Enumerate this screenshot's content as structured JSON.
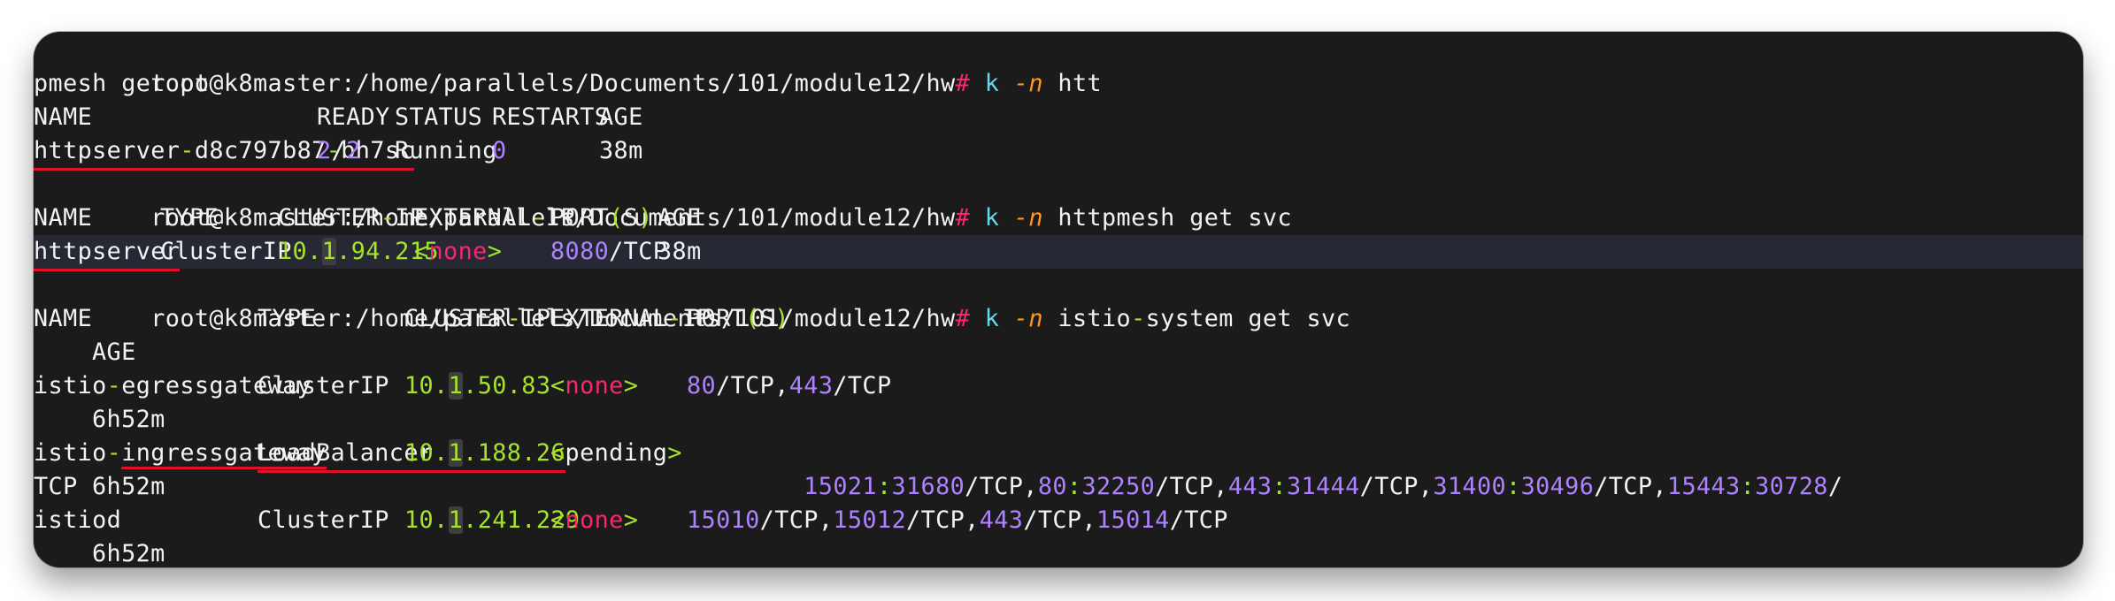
{
  "terminal": {
    "line1": {
      "prompt_user": "root@k8master:/home/parallels/Documents/101/module12/hw",
      "prompt_hash": "#",
      "k": "k",
      "flag": "-n",
      "arg": "htt"
    },
    "line2": {
      "text": "pmesh get po"
    },
    "pods_header": {
      "name": "NAME",
      "ready": "READY",
      "status": "STATUS",
      "restarts": "RESTARTS",
      "age": "AGE"
    },
    "pod_row": {
      "name_a": "httpserver",
      "dash": "-",
      "name_b": "d8c797b87",
      "name_c": "bh7sc",
      "ready_num": "2",
      "ready_sep": "/",
      "ready_den": "2",
      "status": "Running",
      "restarts": "0",
      "age": "38m"
    },
    "cmd2": {
      "prompt_user": "root@k8master:/home/parallels/Documents/101/module12/hw",
      "prompt_hash": "#",
      "k": "k",
      "flag": "-n",
      "rest": "httpmesh get svc"
    },
    "svc_header": {
      "name": "NAME",
      "type": "TYPE",
      "cluster": "CLUSTER",
      "ip": "IP",
      "external": "EXTERNAL",
      "port": "PORT",
      "paren_open": "(",
      "s": "S",
      "paren_close": ")",
      "age": "AGE"
    },
    "svc_row": {
      "name": "httpserver",
      "type": "ClusterIP",
      "ip_a": "10.",
      "ip_b": "1",
      "ip_c": ".94.215",
      "ext_lt": "<",
      "ext": "none",
      "ext_gt": ">",
      "port_num": "8080",
      "port_proto": "/TCP",
      "age": "38m"
    },
    "cmd3": {
      "prompt_user": "root@k8master:/home/parallels/Documents/101/module12/hw",
      "prompt_hash": "#",
      "k": "k",
      "flag": "-n",
      "rest_a": "istio",
      "rest_b": "system get svc"
    },
    "istio_header": {
      "name": "NAME",
      "type": "TYPE",
      "cluster": "CLUSTER",
      "ip": "IP",
      "external": "EXTERNAL",
      "port": "PORT",
      "s": "S",
      "age": "AGE"
    },
    "egress": {
      "name_a": "istio",
      "name_b": "egressgateway",
      "type": "ClusterIP",
      "ip_a": "10.",
      "ip_b": "1",
      "ip_c": ".50.83",
      "ext": "none",
      "p1": "80",
      "t1": "/TCP,",
      "p2": "443",
      "t2": "/TCP",
      "age": "6h52m"
    },
    "ingress": {
      "name_a": "istio",
      "name_b": "ingressgateway",
      "type": "LoadBalancer",
      "ip_a": "10.",
      "ip_b": "1",
      "ip_c": ".188.26",
      "ext": "pending",
      "ports": [
        {
          "a": "15021",
          "b": "31680"
        },
        {
          "a": "80",
          "b": "32250"
        },
        {
          "a": "443",
          "b": "31444"
        },
        {
          "a": "31400",
          "b": "30496"
        },
        {
          "a": "15443",
          "b": "30728"
        }
      ],
      "proto": "/TCP",
      "comma": ",",
      "wrap": "TCP",
      "age": "6h52m"
    },
    "istiod": {
      "name": "istiod",
      "type": "ClusterIP",
      "ip_a": "10.",
      "ip_b": "1",
      "ip_c": ".241.229",
      "ext": "none",
      "ports": [
        "15010",
        "15012",
        "443",
        "15014"
      ],
      "proto": "/TCP",
      "age": "6h52m"
    }
  }
}
